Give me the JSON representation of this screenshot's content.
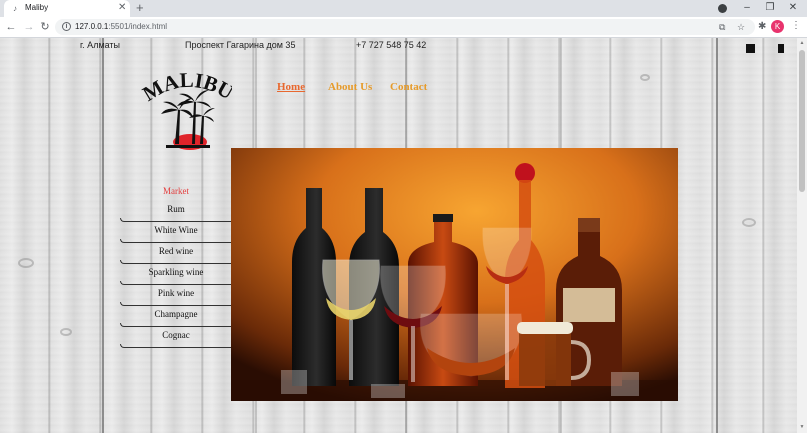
{
  "browser": {
    "tab_title": "Maliby",
    "tab_favicon": "music-note-icon",
    "url_host": "127.0.0.1",
    "url_path": ":5501/index.html",
    "avatar_letter": "K"
  },
  "header": {
    "city": "г. Алматы",
    "address": "Проспект Гагарина дом 35",
    "phone": "+7 727 548 75 42"
  },
  "logo": {
    "text": "MALIBU",
    "colors": {
      "text": "#111111",
      "sun": "#e0242a"
    }
  },
  "nav": {
    "items": [
      {
        "label": "Home"
      },
      {
        "label": "About Us"
      },
      {
        "label": "Contact"
      }
    ]
  },
  "sidebar": {
    "title": "Market",
    "items": [
      "Rum",
      "White Wine",
      "Red wine",
      "Sparkling wine",
      "Pink wine",
      "Champagne",
      "Cognac"
    ]
  },
  "colors": {
    "nav_link": "#e69b2b",
    "nav_active": "#e8682f",
    "market_title": "#e33d3d",
    "hero_bg": "#e5861d"
  }
}
